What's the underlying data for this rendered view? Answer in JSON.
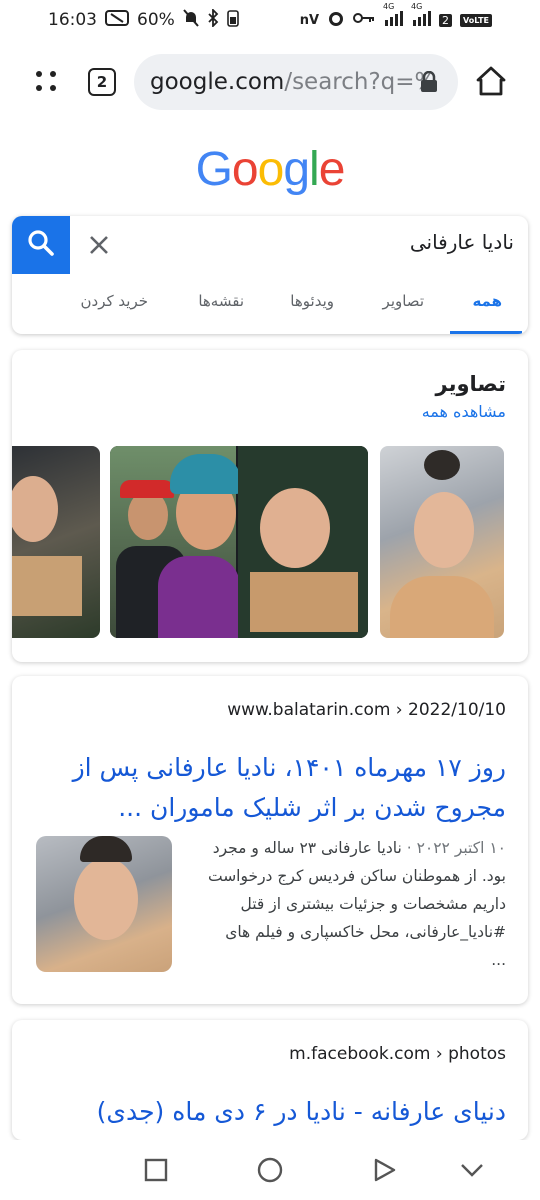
{
  "status_bar": {
    "time": "16:03",
    "battery": "60%",
    "carrier_text": "nV",
    "network_1": "4G",
    "network_2": "4G",
    "sim_badge": "2",
    "volte": "VoLTE"
  },
  "browser": {
    "tab_count": "2",
    "url_host": "google.com",
    "url_path": "/search?q=%"
  },
  "google": {
    "logo_letters": [
      "G",
      "o",
      "o",
      "g",
      "l",
      "e"
    ],
    "logo_colors": [
      "#4285F4",
      "#EA4335",
      "#FBBC05",
      "#4285F4",
      "#34A853",
      "#EA4335"
    ]
  },
  "search": {
    "query": "نادیا عارفانی",
    "tabs": [
      {
        "label": "همه",
        "active": true
      },
      {
        "label": "تصاویر",
        "active": false
      },
      {
        "label": "ویدئوها",
        "active": false
      },
      {
        "label": "نقشه‌ها",
        "active": false
      },
      {
        "label": "خرید کردن",
        "active": false
      }
    ]
  },
  "images_section": {
    "title": "تصاویر",
    "see_all": "مشاهده همه"
  },
  "results": [
    {
      "source_url": "www.balatarin.com › 2022/10/10",
      "title": "روز ۱۷ مهرماه ۱۴۰۱، نادیا عارفانی پس از مجروح شدن بر اثر شلیک ماموران ...",
      "date": "۱۰ اکتبر ۲۰۲۲ ·",
      "snippet": "نادیا عارفانی ۲۳ ساله و مجرد بود. از هموطنان ساکن فردیس کرج درخواست داریم مشخصات و جزئیات بیشتری از قتل #نادیا_عارفانی، محل خاکسپاری و فیلم های ..."
    },
    {
      "source_url": "m.facebook.com › photos",
      "title": "دنیای عارفانه - نادیا در ۶ دی ماه (جدی)"
    }
  ],
  "colors": {
    "accent": "#1a73e8",
    "link": "#1558d6"
  }
}
